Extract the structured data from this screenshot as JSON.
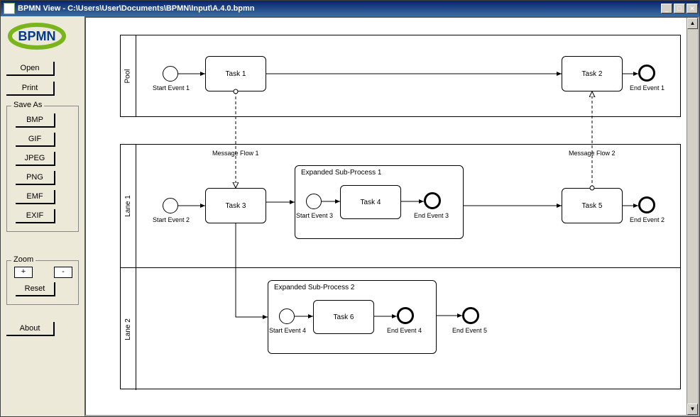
{
  "titlebar": {
    "app_name": "BPMN View",
    "file_path": "C:\\Users\\User\\Documents\\BPMN\\Input\\A.4.0.bpmn"
  },
  "logo_text": "BPMN",
  "buttons": {
    "open": "Open",
    "print": "Print",
    "about": "About",
    "reset": "Reset"
  },
  "save_as": {
    "label": "Save As",
    "formats": [
      "BMP",
      "GIF",
      "JPEG",
      "PNG",
      "EMF",
      "EXIF"
    ]
  },
  "zoom": {
    "label": "Zoom",
    "plus": "+",
    "minus": "-"
  },
  "diagram": {
    "pool1": {
      "label": "Pool"
    },
    "pool2": {
      "lane1": "Lane 1",
      "lane2": "Lane 2"
    },
    "events": {
      "start1": "Start Event 1",
      "end1": "End Event 1",
      "start2": "Start Event 2",
      "end2": "End Event 2",
      "start3": "Start Event 3",
      "end3": "End Event 3",
      "start4": "Start Event 4",
      "end4": "End Event 4",
      "end5": "End Event 5"
    },
    "tasks": {
      "t1": "Task 1",
      "t2": "Task 2",
      "t3": "Task 3",
      "t4": "Task 4",
      "t5": "Task 5",
      "t6": "Task 6"
    },
    "subprocs": {
      "sp1": "Expanded Sub-Process 1",
      "sp2": "Expanded Sub-Process 2"
    },
    "flows": {
      "mf1": "Message Flow 1",
      "mf2": "Message Flow 2"
    }
  }
}
